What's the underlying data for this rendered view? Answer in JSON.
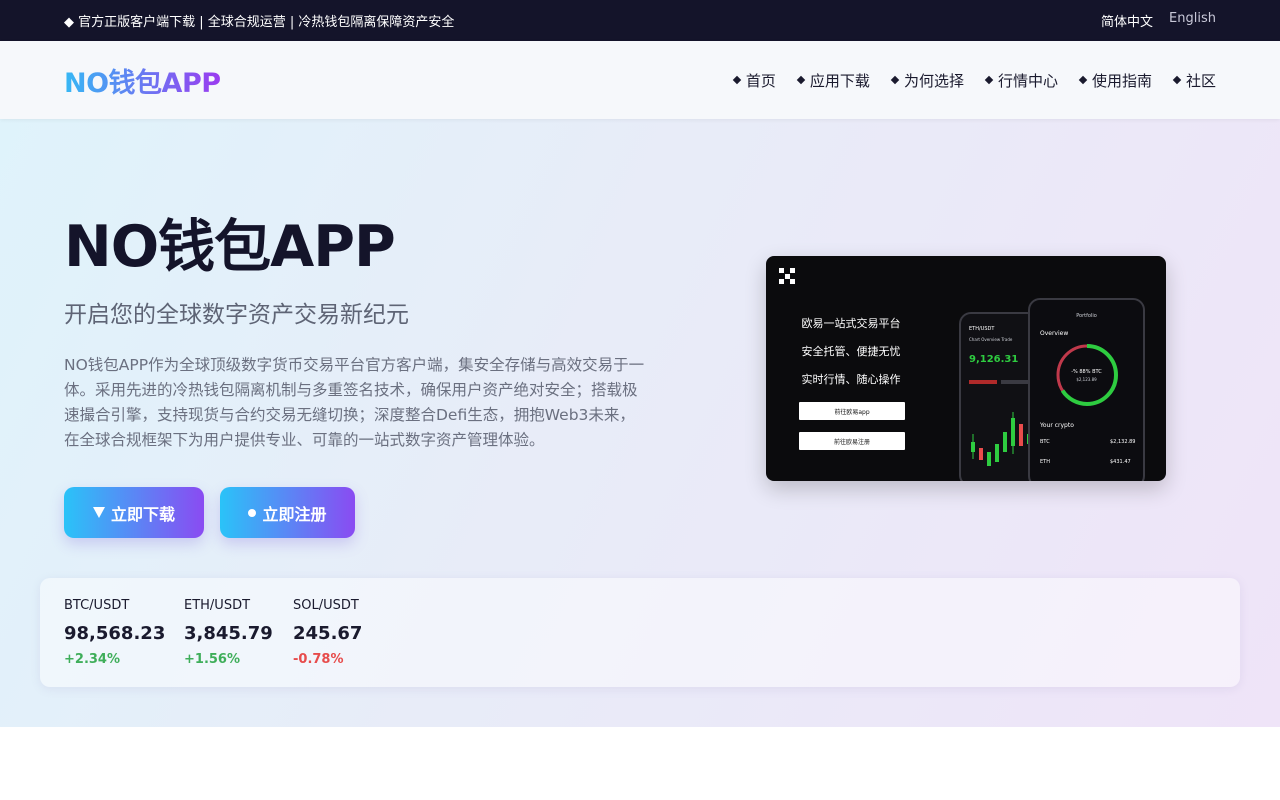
{
  "topbar": {
    "notice": "◆ 官方正版客户端下载 | 全球合规运营 | 冷热钱包隔离保障资产安全",
    "lang_zh": "简体中文",
    "lang_en": "English"
  },
  "header": {
    "logo": "NO钱包APP",
    "nav": [
      {
        "label": "首页"
      },
      {
        "label": "应用下载"
      },
      {
        "label": "为何选择"
      },
      {
        "label": "行情中心"
      },
      {
        "label": "使用指南"
      },
      {
        "label": "社区"
      }
    ]
  },
  "hero": {
    "title": "NO钱包APP",
    "subtitle": "开启您的全球数字资产交易新纪元",
    "description": "NO钱包APP作为全球顶级数字货币交易平台官方客户端，集安全存储与高效交易于一体。采用先进的冷热钱包隔离机制与多重签名技术，确保用户资产绝对安全；搭载极速撮合引擎，支持现货与合约交易无缝切换；深度整合Defi生态，拥抱Web3未来，在全球合规框架下为用户提供专业、可靠的一站式数字资产管理体验。",
    "download_label": "立即下载",
    "register_label": "立即注册"
  },
  "promo": {
    "line1": "欧易一站式交易平台",
    "line2": "安全托管、便捷无忧",
    "line3": "实时行情、随心操作",
    "btn1": "前往欧易app",
    "btn2": "前往欧易注册",
    "phone1": {
      "pair": "ETH/USDT",
      "tabs": "Chart   Overview   Trade",
      "price": "9,126.31"
    },
    "phone2": {
      "header": "Portfolio",
      "overview": "Overview",
      "ring_pct": "-% 88% BTC",
      "ring_val": "$2,123.89",
      "your_crypto": "Your crypto",
      "rows": [
        {
          "name": "BTC",
          "value": "$2,132.89"
        },
        {
          "name": "ETH",
          "value": "$431.47"
        }
      ]
    }
  },
  "ticker": [
    {
      "pair": "BTC/USDT",
      "price": "98,568.23",
      "change": "+2.34%",
      "direction": "up"
    },
    {
      "pair": "ETH/USDT",
      "price": "3,845.79",
      "change": "+1.56%",
      "direction": "up"
    },
    {
      "pair": "SOL/USDT",
      "price": "245.67",
      "change": "-0.78%",
      "direction": "down"
    }
  ],
  "colors": {
    "topbar_bg": "#14142a",
    "accent_start": "#2ac3f8",
    "accent_end": "#8a4bf2",
    "up": "#3fae5a",
    "down": "#e74c4c"
  }
}
